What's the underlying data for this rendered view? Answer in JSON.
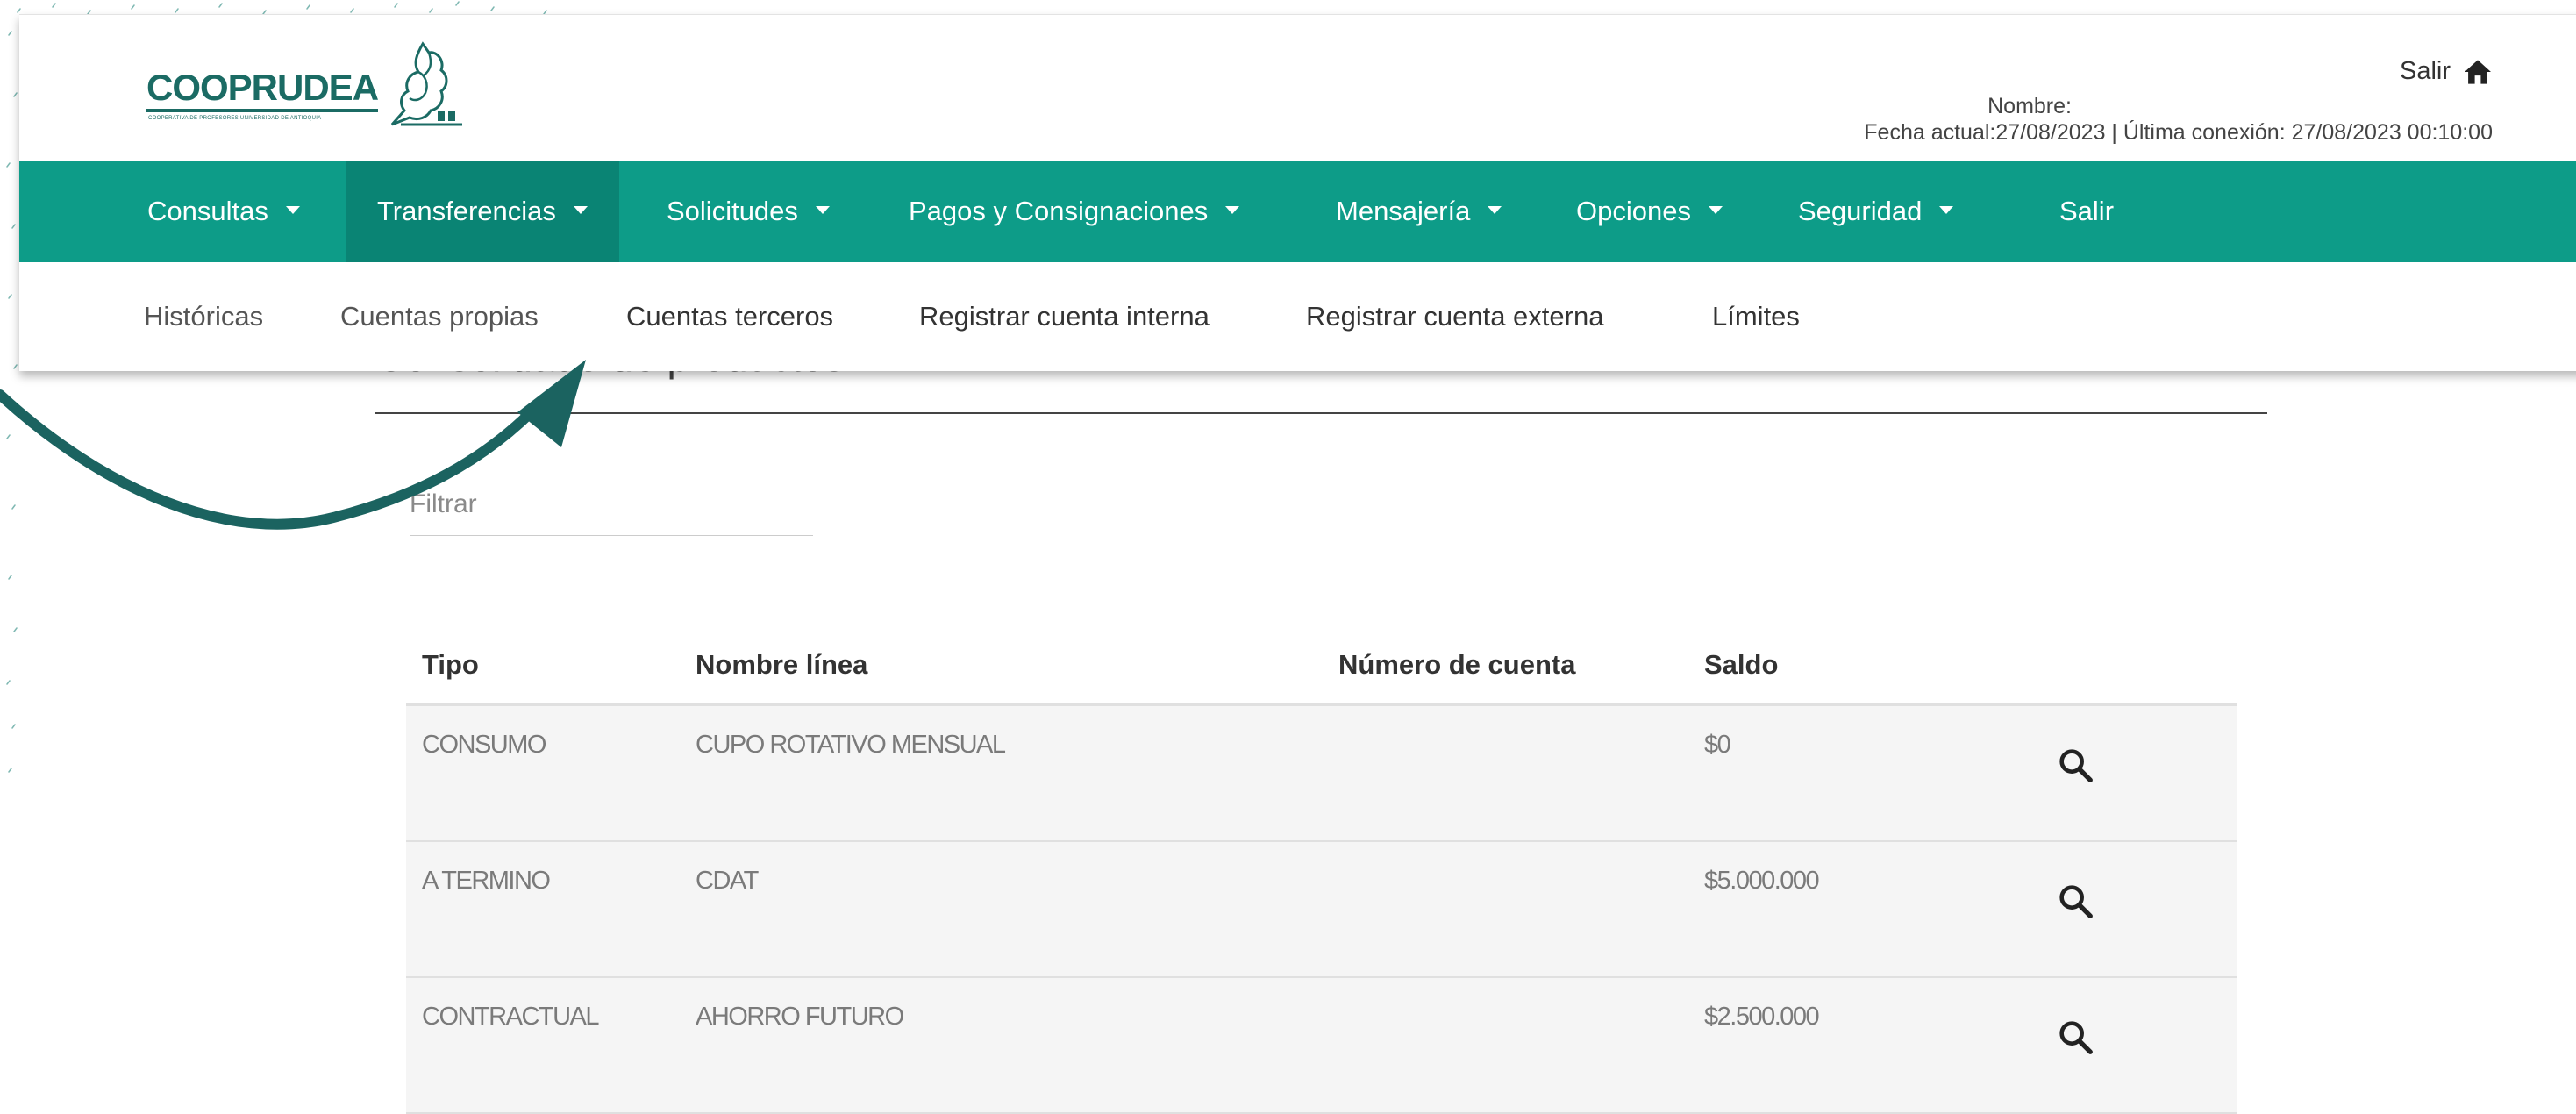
{
  "header": {
    "logo_text": "COOPRUDEA",
    "logo_subtext": "COOPERATIVA DE PROFESORES UNIVERSIDAD DE ANTIOQUIA",
    "salir_label": "Salir",
    "nombre_label": "Nombre:",
    "session_info": "Fecha actual:27/08/2023 | Última conexión: 27/08/2023 00:10:00"
  },
  "nav": {
    "items": [
      {
        "label": "Consultas"
      },
      {
        "label": "Transferencias"
      },
      {
        "label": "Solicitudes"
      },
      {
        "label": "Pagos y Consignaciones"
      },
      {
        "label": "Mensajería"
      },
      {
        "label": "Opciones"
      },
      {
        "label": "Seguridad"
      },
      {
        "label": "Salir"
      }
    ],
    "active": "Transferencias"
  },
  "subnav": {
    "items": [
      {
        "label": "Históricas"
      },
      {
        "label": "Cuentas propias"
      },
      {
        "label": "Cuentas terceros"
      },
      {
        "label": "Registrar cuenta interna"
      },
      {
        "label": "Registrar cuenta externa"
      },
      {
        "label": "Límites"
      }
    ]
  },
  "page": {
    "heading": "Consolidado de productos",
    "filter_placeholder": "Filtrar"
  },
  "table": {
    "columns": [
      "Tipo",
      "Nombre línea",
      "Número de cuenta",
      "Saldo"
    ],
    "rows": [
      {
        "tipo": "CONSUMO",
        "nombre": "CUPO ROTATIVO MENSUAL",
        "numero": "",
        "saldo": "$0"
      },
      {
        "tipo": "A TERMINO",
        "nombre": "CDAT",
        "numero": "",
        "saldo": "$5.000.000"
      },
      {
        "tipo": "CONTRACTUAL",
        "nombre": "AHORRO FUTURO",
        "numero": "",
        "saldo": "$2.500.000"
      }
    ]
  },
  "icons": {
    "home": "home-icon",
    "search": "search-icon",
    "arrow": "curved-arrow"
  },
  "colors": {
    "nav_bg": "#0d9c88",
    "nav_active": "#0a8474",
    "arrow": "#1b6360",
    "brand": "#1b6b64"
  }
}
